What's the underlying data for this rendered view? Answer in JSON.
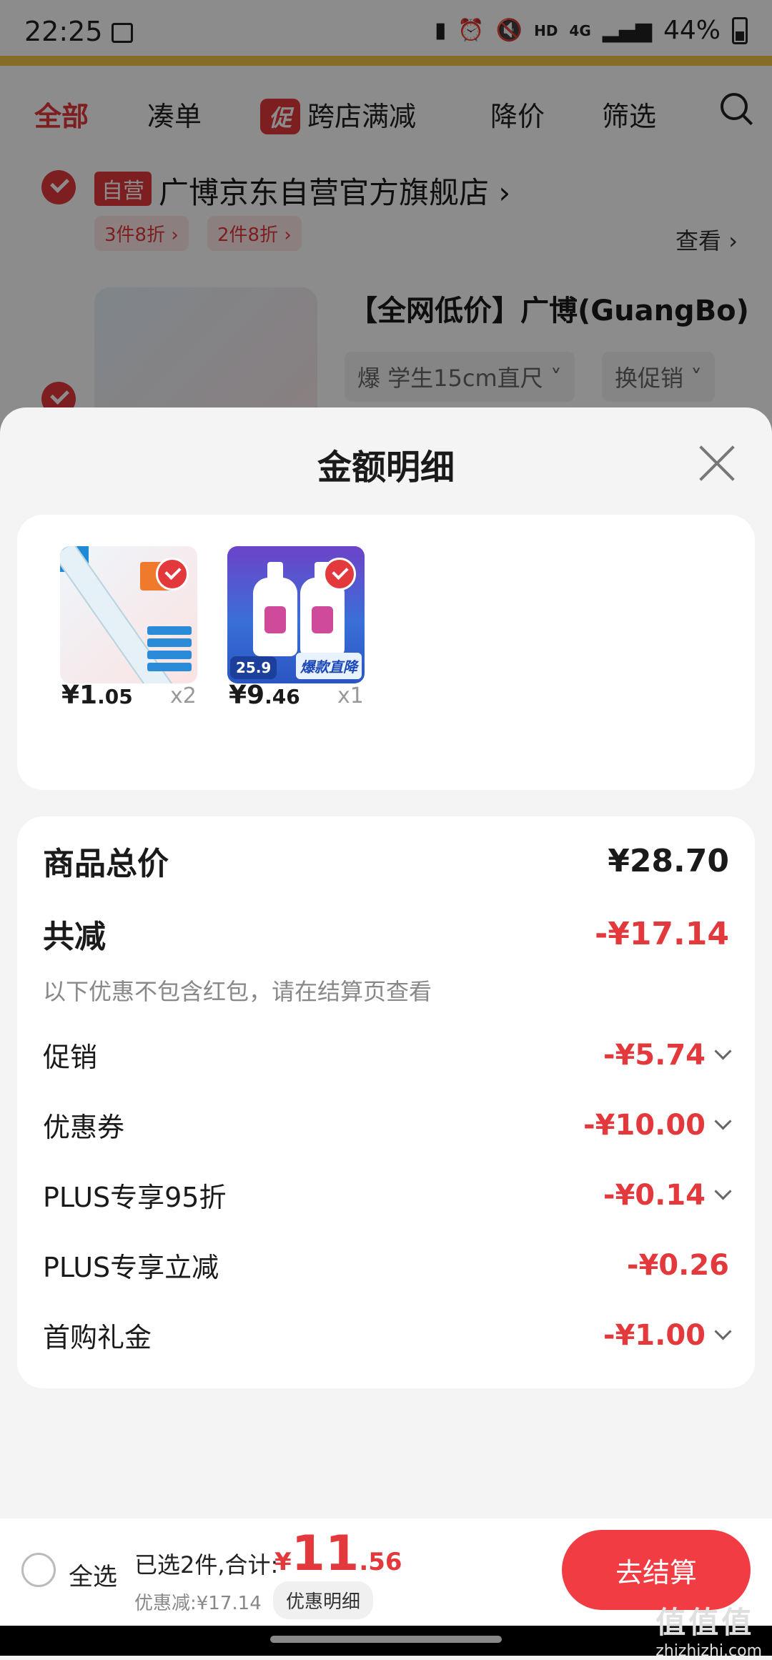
{
  "status_bar": {
    "time": "22:25",
    "icons": [
      "gallery-icon",
      "battery-saver-icon",
      "alarm-icon",
      "mute-icon"
    ],
    "hd": "HD",
    "network": "4G",
    "battery": "44%"
  },
  "top_nav": {
    "tabs": [
      {
        "label": "全部",
        "active": true
      },
      {
        "label": "凑单"
      },
      {
        "label": "跨店满减",
        "badge": "促"
      },
      {
        "label": "降价"
      },
      {
        "label": "筛选"
      }
    ]
  },
  "shop": {
    "tag": "自营",
    "name": "广博京东自营官方旗舰店 ›",
    "promos": [
      "3件8折 ›",
      "2件8折 ›"
    ],
    "view": "查看 ›",
    "product_title": "【全网低价】广博(GuangBo)",
    "spec": "爆 学生15cm直尺 ˅",
    "change_promo": "换促销 ˅"
  },
  "sheet": {
    "title": "金额明细",
    "items": [
      {
        "price_int": "¥1",
        "price_dec": ".05",
        "qty": "x2"
      },
      {
        "price_int": "¥9",
        "price_dec": ".46",
        "qty": "x1",
        "img_price": "25.9",
        "img_banner": "爆款直降"
      }
    ],
    "summary": {
      "total_label": "商品总价",
      "total_value": "¥28.70",
      "reduce_label": "共减",
      "reduce_value": "-¥17.14",
      "note": "以下优惠不包含红包，请在结算页查看",
      "rows": [
        {
          "label": "促销",
          "value": "-¥5.74",
          "expandable": true
        },
        {
          "label": "优惠券",
          "value": "-¥10.00",
          "expandable": true
        },
        {
          "label": "PLUS专享95折",
          "value": "-¥0.14",
          "expandable": true
        },
        {
          "label": "PLUS专享立减",
          "value": "-¥0.26",
          "expandable": false
        },
        {
          "label": "首购礼金",
          "value": "-¥1.00",
          "expandable": true
        }
      ]
    }
  },
  "bottom_bar": {
    "select_all": "全选",
    "selected": "已选2件,合计:",
    "total_cur": "¥",
    "total_int": "11",
    "total_dec": ".56",
    "discount": "优惠减:¥17.14",
    "detail_chip": "优惠明细",
    "checkout": "去结算"
  },
  "watermark": {
    "big": "值值值",
    "small": "zhizhizhi.com"
  },
  "colors": {
    "accent": "#e4393c",
    "checkout": "#f13c44"
  }
}
